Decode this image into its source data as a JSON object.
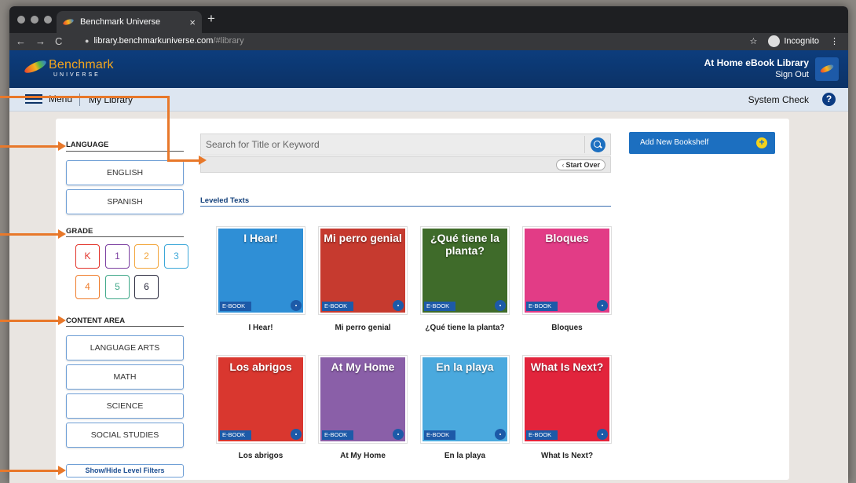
{
  "browser": {
    "tab_title": "Benchmark Universe",
    "tab_close": "×",
    "new_tab": "+",
    "url_domain": "library.benchmarkuniverse.com",
    "url_hash": "/#library",
    "incognito_label": "Incognito",
    "nav_back": "←",
    "nav_forward": "→",
    "nav_reload": "C",
    "star": "☆",
    "more": "⋮",
    "lock": "🔒"
  },
  "header": {
    "logo_text": "Benchmark",
    "logo_sub": "UNIVERSE",
    "library_title": "At Home eBook Library",
    "sign_out": "Sign Out"
  },
  "menubar": {
    "menu_label": "Menu",
    "my_library": "My Library",
    "system_check": "System Check",
    "help": "?"
  },
  "filters": {
    "language_label": "LANGUAGE",
    "languages": [
      "ENGLISH",
      "SPANISH"
    ],
    "grade_label": "GRADE",
    "grades": [
      {
        "label": "K",
        "color": "#e2342b"
      },
      {
        "label": "1",
        "color": "#7b3fa0"
      },
      {
        "label": "2",
        "color": "#f2a53a"
      },
      {
        "label": "3",
        "color": "#3ba7d8"
      },
      {
        "label": "4",
        "color": "#ef7d2c"
      },
      {
        "label": "5",
        "color": "#40a889"
      },
      {
        "label": "6",
        "color": "#2b2b3f"
      }
    ],
    "content_label": "CONTENT AREA",
    "content_areas": [
      "LANGUAGE ARTS",
      "MATH",
      "SCIENCE",
      "SOCIAL STUDIES"
    ],
    "toggle_label": "Show/Hide Level Filters"
  },
  "search": {
    "placeholder": "Search for Title or Keyword",
    "start_over": "Start Over",
    "start_over_chevron": "‹"
  },
  "bookshelf": {
    "add_label": "Add New Bookshelf",
    "add_icon": "+"
  },
  "section_title": "Leveled Texts",
  "ebook_tag": "E-BOOK",
  "books": [
    {
      "title": "I Hear!",
      "cover_title": "I Hear!",
      "cover_color": "#2f8fd6"
    },
    {
      "title": "Mi perro genial",
      "cover_title": "Mi perro genial",
      "cover_color": "#c63a2f"
    },
    {
      "title": "¿Qué tiene la planta?",
      "cover_title": "¿Qué tiene la planta?",
      "cover_color": "#3f6b2a"
    },
    {
      "title": "Bloques",
      "cover_title": "Bloques",
      "cover_color": "#e23c86"
    },
    {
      "title": "Los abrigos",
      "cover_title": "Los abrigos",
      "cover_color": "#d9372f"
    },
    {
      "title": "At My Home",
      "cover_title": "At My Home",
      "cover_color": "#8a5fa8"
    },
    {
      "title": "En la playa",
      "cover_title": "En la playa",
      "cover_color": "#4aa9de"
    },
    {
      "title": "What Is Next?",
      "cover_title": "What Is Next?",
      "cover_color": "#e2243c"
    }
  ]
}
